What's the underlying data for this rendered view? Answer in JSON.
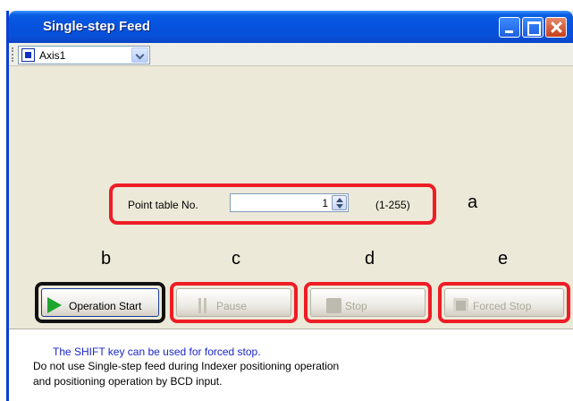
{
  "window": {
    "title": "Single-step Feed"
  },
  "toolbar": {
    "axis_value": "Axis1"
  },
  "point_table": {
    "label": "Point table No.",
    "value": "1",
    "range": "(1-255)"
  },
  "callouts": {
    "a": "a",
    "b": "b",
    "c": "c",
    "d": "d",
    "e": "e"
  },
  "buttons": {
    "operation_start": "Operation Start",
    "pause": "Pause",
    "stop": "Stop",
    "forced_stop": "Forced Stop"
  },
  "messages": {
    "hint": "The SHIFT key can be used for forced stop.",
    "warning_line1": "Do not use Single-step feed during Indexer positioning operation",
    "warning_line2": "and positioning operation by BCD input."
  },
  "colors": {
    "highlight": "#ee1c25",
    "hint_text": "#1a27c6",
    "titlebar": "#0653df"
  },
  "icons": [
    "minimize-icon",
    "maximize-icon",
    "close-icon",
    "axis-icon",
    "dropdown-arrow-icon",
    "spinner-icon",
    "play-icon",
    "pause-icon",
    "stop-icon",
    "forced-stop-icon"
  ]
}
